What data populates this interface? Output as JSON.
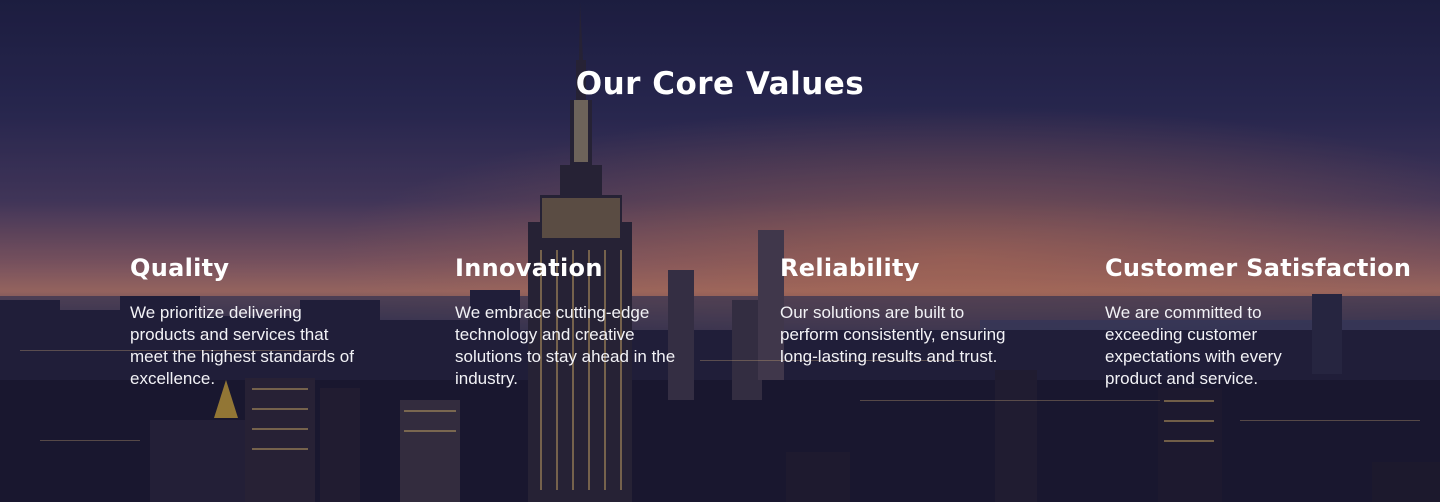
{
  "section": {
    "title": "Our Core Values"
  },
  "values": [
    {
      "title": "Quality",
      "description": "We prioritize delivering products and services that meet the highest standards of excellence."
    },
    {
      "title": "Innovation",
      "description": "We embrace cutting-edge technology and creative solutions to stay ahead in the industry."
    },
    {
      "title": "Reliability",
      "description": "Our solutions are built to perform consistently, ensuring long-lasting results and trust."
    },
    {
      "title": "Customer Satisfaction",
      "description": "We are committed to exceeding customer expectations with every product and service."
    }
  ],
  "colors": {
    "text": "#ffffff",
    "sky_top": "#1e2044",
    "sunset": "#b0766a",
    "city_dark": "#14142a"
  }
}
